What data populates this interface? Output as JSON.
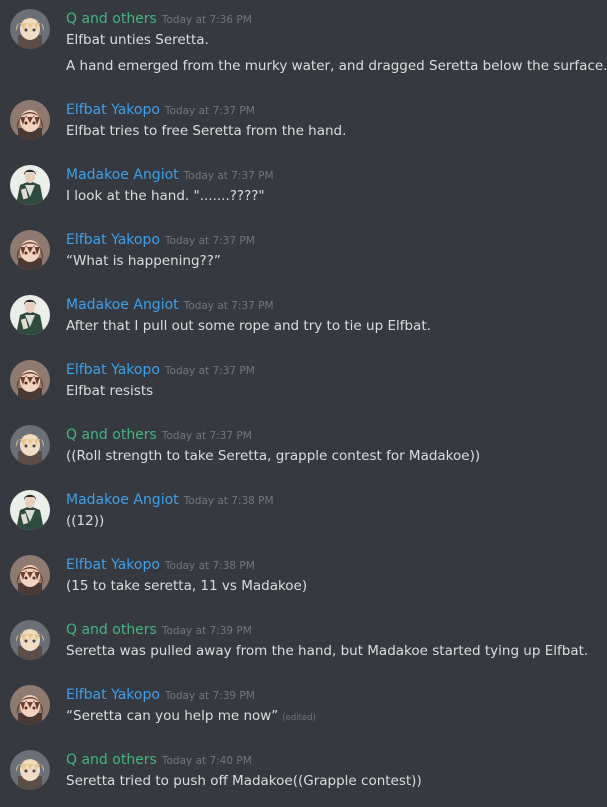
{
  "colors": {
    "background": "#36393f",
    "text": "#dcddde",
    "timestamp": "#72767d",
    "q_name": "#43b581",
    "player_name": "#3fa0ea"
  },
  "messages": [
    {
      "author": "Q and others",
      "avatar": "blonde-character-avatar",
      "timestamp": "Today at 7:36 PM",
      "lines": [
        "Elfbat unties Seretta.",
        "A hand emerged from the murky water, and dragged Seretta below the surface."
      ]
    },
    {
      "author": "Elfbat Yakopo",
      "avatar": "brown-hair-character-avatar",
      "timestamp": "Today at 7:37 PM",
      "lines": [
        "Elfbat tries to free Seretta from the hand."
      ]
    },
    {
      "author": "Madakoe Angiot",
      "avatar": "green-coat-character-avatar",
      "timestamp": "Today at 7:37 PM",
      "lines": [
        "I look at the hand. \".......????\""
      ]
    },
    {
      "author": "Elfbat Yakopo",
      "avatar": "brown-hair-character-avatar",
      "timestamp": "Today at 7:37 PM",
      "lines": [
        "“What is happening??”"
      ]
    },
    {
      "author": "Madakoe Angiot",
      "avatar": "green-coat-character-avatar",
      "timestamp": "Today at 7:37 PM",
      "lines": [
        "After that I pull out some rope and try to tie up Elfbat."
      ]
    },
    {
      "author": "Elfbat Yakopo",
      "avatar": "brown-hair-character-avatar",
      "timestamp": "Today at 7:37 PM",
      "lines": [
        "Elfbat resists"
      ]
    },
    {
      "author": "Q and others",
      "avatar": "blonde-character-avatar",
      "timestamp": "Today at 7:37 PM",
      "lines": [
        "((Roll strength to take Seretta, grapple contest for Madakoe))"
      ]
    },
    {
      "author": "Madakoe Angiot",
      "avatar": "green-coat-character-avatar",
      "timestamp": "Today at 7:38 PM",
      "lines": [
        "((12))"
      ]
    },
    {
      "author": "Elfbat Yakopo",
      "avatar": "brown-hair-character-avatar",
      "timestamp": "Today at 7:38 PM",
      "lines": [
        "(15 to take seretta, 11 vs Madakoe)"
      ]
    },
    {
      "author": "Q and others",
      "avatar": "blonde-character-avatar",
      "timestamp": "Today at 7:39 PM",
      "lines": [
        "Seretta was pulled away from the hand, but Madakoe started tying up Elfbat."
      ]
    },
    {
      "author": "Elfbat Yakopo",
      "avatar": "brown-hair-character-avatar",
      "timestamp": "Today at 7:39 PM",
      "lines": [
        "“Seretta can you help me now”"
      ],
      "edited": "(edited)"
    },
    {
      "author": "Q and others",
      "avatar": "blonde-character-avatar",
      "timestamp": "Today at 7:40 PM",
      "lines": [
        "Seretta tried to push off Madakoe((Grapple contest))"
      ]
    }
  ]
}
